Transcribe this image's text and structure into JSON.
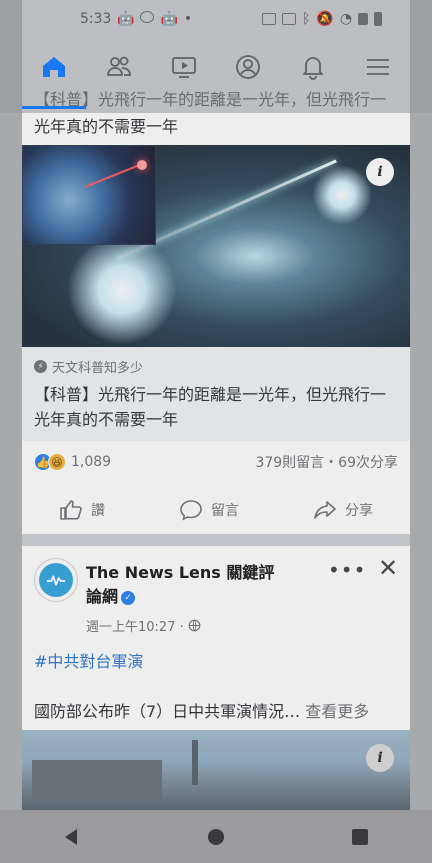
{
  "status_bar": {
    "time": "5:33"
  },
  "nav_tabs": [
    {
      "name": "home",
      "icon": "home-icon"
    },
    {
      "name": "friends",
      "icon": "friends-icon"
    },
    {
      "name": "watch",
      "icon": "video-icon"
    },
    {
      "name": "profile",
      "icon": "profile-icon"
    },
    {
      "name": "notifications",
      "icon": "bell-icon"
    },
    {
      "name": "menu",
      "icon": "hamburger-menu-icon"
    }
  ],
  "post1": {
    "top_text": "【科普】光飛行一年的距離是一光年，但光飛行一光年真的不需要一年",
    "link_source": "天文科普知多少",
    "link_title": "【科普】光飛行一年的距離是一光年，但光飛行一光年真的不需要一年",
    "reaction_count": "1,089",
    "comments_shares": "379則留言・69次分享",
    "actions": {
      "like": "讚",
      "comment": "留言",
      "share": "分享"
    },
    "image_badge": "i"
  },
  "post2": {
    "page_name": "The News Lens 關鍵評論網",
    "time": "週一上午10:27 ·",
    "hashtag": "#中共對台軍演",
    "text": "國防部公布昨（7）日中共軍演情況…",
    "see_more": "查看更多",
    "image_badge": "i",
    "more_label": "•••",
    "close_label": "✕"
  },
  "colors": {
    "accent": "#1877f2",
    "hashtag": "#1c6ac8",
    "secondary_text": "#65676b"
  }
}
